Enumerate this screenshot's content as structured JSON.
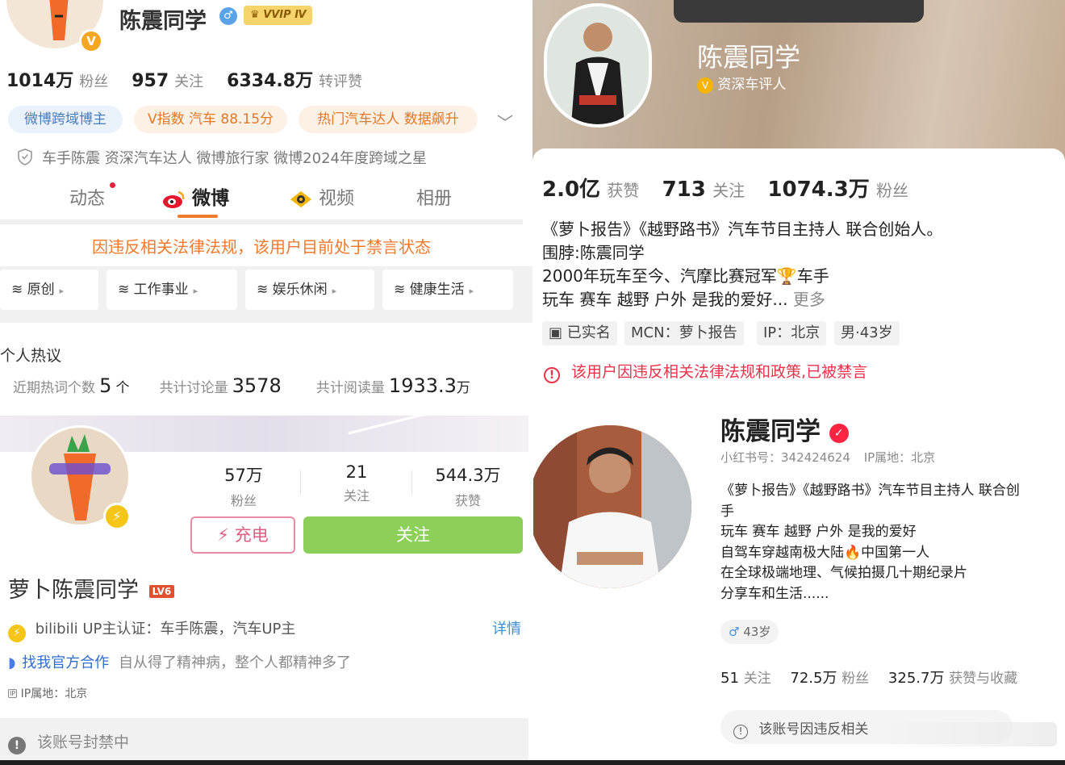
{
  "weibo": {
    "name": "陈震同学",
    "vip_badge": "VVIP Ⅳ",
    "stats": [
      {
        "value": "1014万",
        "label": "粉丝"
      },
      {
        "value": "957",
        "label": "关注"
      },
      {
        "value": "6334.8万",
        "label": "转评赞"
      }
    ],
    "tags": [
      "微博跨域博主",
      "V指数 汽车 88.15分",
      "热门汽车达人 数据飙升"
    ],
    "verification": "车手陈震 资深汽车达人 微博旅行家 微博2024年度跨域之星",
    "tabs": [
      "动态",
      "微博",
      "视频",
      "相册"
    ],
    "ban_notice": "因违反相关法律法规，该用户目前处于禁言状态",
    "categories": [
      "原创",
      "工作事业",
      "娱乐休闲",
      "健康生活"
    ],
    "hot_section": {
      "title": "个人热议",
      "items": [
        {
          "label": "近期热词个数",
          "value": "5",
          "unit": "个"
        },
        {
          "label": "共计讨论量",
          "value": "3578",
          "unit": ""
        },
        {
          "label": "共计阅读量",
          "value": "1933.3",
          "unit": "万"
        }
      ]
    },
    "colors": {
      "ban": "#f07a2c",
      "tag_blue_bg": "#eaf2fb",
      "tag_orange_bg": "#fdf1e6"
    }
  },
  "douyin": {
    "name": "陈震同学",
    "subtitle": "资深车评人",
    "stats": [
      {
        "value": "2.0亿",
        "label": "获赞"
      },
      {
        "value": "713",
        "label": "关注"
      },
      {
        "value": "1074.3万",
        "label": "粉丝"
      }
    ],
    "bio_lines": [
      "《萝卜报告》《越野路书》汽车节目主持人 联合创始人。",
      "围脖:陈震同学",
      "2000年玩车至今、汽摩比赛冠军🏆车手",
      "玩车 赛车 越野 户外 是我的爱好..."
    ],
    "more_label": "更多",
    "tags": [
      "已实名",
      "MCN：萝卜报告",
      "IP：北京",
      "男·43岁"
    ],
    "ban_notice": "该用户因违反相关法律法规和政策,已被禁言"
  },
  "bilibili": {
    "stats": [
      {
        "value": "57万",
        "label": "粉丝"
      },
      {
        "value": "21",
        "label": "关注"
      },
      {
        "value": "544.3万",
        "label": "获赞"
      }
    ],
    "charge_label": "充电",
    "follow_label": "关注",
    "name": "萝卜陈震同学",
    "level": "LV6",
    "cert": "bilibili UP主认证：车手陈震，汽车UP主",
    "details_label": "详情",
    "coop_label": "找我官方合作",
    "coop_text": "自从得了精神病，整个人都精神多了",
    "ip": "IP属地：北京",
    "banned": "该账号封禁中"
  },
  "xiaohongshu": {
    "name": "陈震同学",
    "id_text": "小红书号：342424624",
    "ip_text": "IP属地：北京",
    "bio_lines": [
      "《萝卜报告》《越野路书》汽车节目主持人 联合创",
      "手",
      "玩车 赛车 越野 户外 是我的爱好",
      "自驾车穿越南极大陆🔥中国第一人",
      "在全球极端地理、气候拍摄几十期纪录片",
      "分享车和生活......"
    ],
    "age_tag": "43岁",
    "stats": [
      {
        "value": "51",
        "label": "关注"
      },
      {
        "value": "72.5万",
        "label": "粉丝"
      },
      {
        "value": "325.7万",
        "label": "获赞与收藏"
      }
    ],
    "ban_notice": "该账号因违反相关"
  }
}
